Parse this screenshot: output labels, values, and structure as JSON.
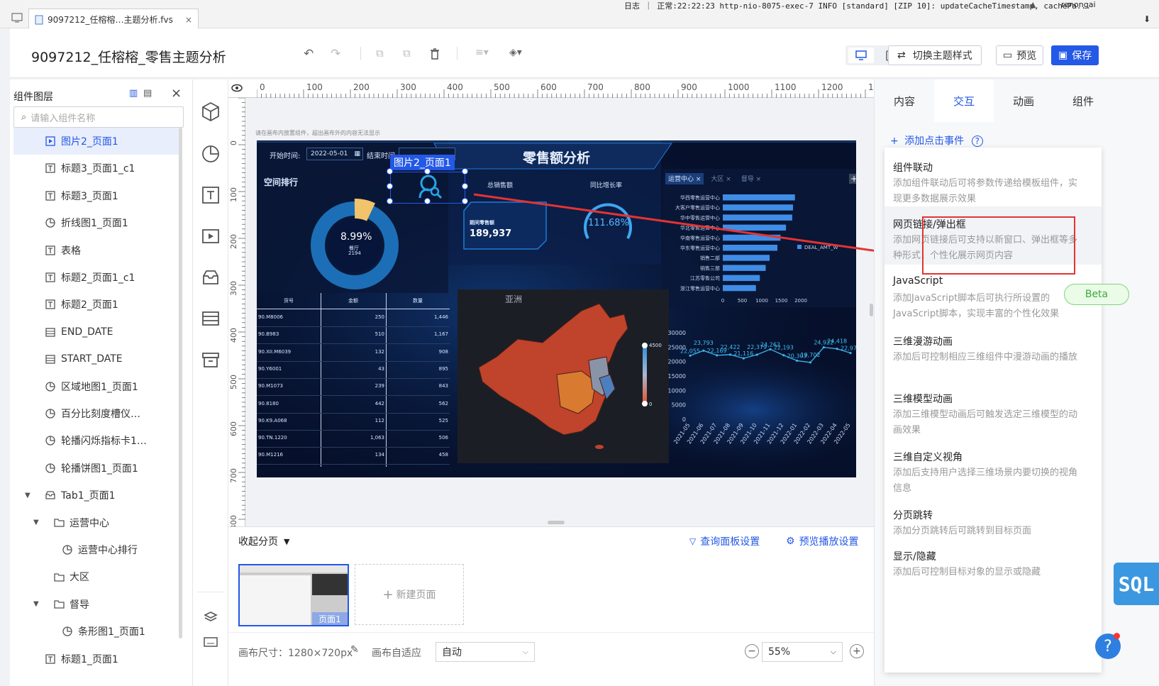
{
  "os": {
    "tab_title": "9097212_任榕榕…主题分析.fvs",
    "log_text": "日志 ｜ 正常:22:22:23 http-nio-8075-exec-7 INFO [standard] [ZIP 10]: updateCacheTimestamp, cachePa...",
    "user": "renongai"
  },
  "header": {
    "title": "9097212_任榕榕_零售主题分析",
    "switch_theme": "切换主题样式",
    "preview": "预览",
    "save": "保存"
  },
  "layers": {
    "title": "组件图层",
    "search_placeholder": "请输入组件名称",
    "items": [
      {
        "label": "图片2_页面1",
        "icon": "image-icon",
        "indent": 0,
        "selected": true
      },
      {
        "label": "标题3_页面1_c1",
        "icon": "text-icon",
        "indent": 0
      },
      {
        "label": "标题3_页面1",
        "icon": "text-icon",
        "indent": 0
      },
      {
        "label": "折线图1_页面1",
        "icon": "chart-icon",
        "indent": 0
      },
      {
        "label": "表格",
        "icon": "text-icon",
        "indent": 0
      },
      {
        "label": "标题2_页面1_c1",
        "icon": "text-icon",
        "indent": 0
      },
      {
        "label": "标题2_页面1",
        "icon": "text-icon",
        "indent": 0
      },
      {
        "label": "END_DATE",
        "icon": "date-icon",
        "indent": 0
      },
      {
        "label": "START_DATE",
        "icon": "date-icon",
        "indent": 0
      },
      {
        "label": "区域地图1_页面1",
        "icon": "chart-icon",
        "indent": 0
      },
      {
        "label": "百分比刻度槽仪…",
        "icon": "chart-icon",
        "indent": 0
      },
      {
        "label": "轮播闪烁指标卡1…",
        "icon": "chart-icon",
        "indent": 0
      },
      {
        "label": "轮播饼图1_页面1",
        "icon": "chart-icon",
        "indent": 0
      },
      {
        "label": "Tab1_页面1",
        "icon": "tab-icon",
        "indent": 0,
        "arrow": true
      },
      {
        "label": "运营中心",
        "icon": "folder-icon",
        "indent": 1,
        "arrow": true
      },
      {
        "label": "运营中心排行",
        "icon": "chart-icon",
        "indent": 2
      },
      {
        "label": "大区",
        "icon": "folder-icon",
        "indent": 1
      },
      {
        "label": "督导",
        "icon": "folder-icon",
        "indent": 1,
        "arrow": true
      },
      {
        "label": "条形图1_页面1",
        "icon": "chart-icon",
        "indent": 2
      },
      {
        "label": "标题1_页面1",
        "icon": "text-icon",
        "indent": 0
      }
    ]
  },
  "canvas": {
    "hint": "请在画布内放置组件，超出画布外的内容无法显示",
    "ruler_top": [
      "0",
      "100",
      "200",
      "300",
      "400",
      "500",
      "600",
      "700",
      "800",
      "900",
      "1000",
      "1100",
      "1200",
      "1"
    ],
    "ruler_left": [
      "0",
      "100",
      "200",
      "300",
      "400",
      "500",
      "600",
      "700",
      "800"
    ],
    "selected_label": "图片2_页面1"
  },
  "dashboard": {
    "title": "零售额分析",
    "start_label": "开始时间:",
    "start_date": "2022-05-01",
    "end_label": "结束时间",
    "section_rank": "空间排行",
    "donut_pct": "8.99%",
    "donut_sub1": "餐厅",
    "donut_sub2": "2194",
    "total_label": "总销售额",
    "yoy_label": "同比增长率",
    "card_label": "期间零售额",
    "card_value": "189,937",
    "gauge_value": "111.68%",
    "rank_tabs": [
      "运营中心 ×",
      "大区 ×",
      "督导 ×"
    ],
    "rank_legend": "DEAL_AMT_W",
    "rank_axis": [
      "0",
      "500",
      "1000",
      "1500",
      "2000"
    ],
    "table_headers": [
      "货号",
      "金额",
      "数量"
    ],
    "table_rows": [
      [
        "90.M8006",
        "250",
        "1,446"
      ],
      [
        "90.B983",
        "510",
        "1,167"
      ],
      [
        "90.XII.M6039",
        "132",
        "908"
      ],
      [
        "90.Y6001",
        "43",
        "895"
      ],
      [
        "90.M1073",
        "239",
        "843"
      ],
      [
        "90.8180",
        "442",
        "562"
      ],
      [
        "90.K9.A068",
        "112",
        "525"
      ],
      [
        "90.TN.1220",
        "1,063",
        "506"
      ],
      [
        "90.M1216",
        "134",
        "458"
      ]
    ],
    "map_label_asia": "亚洲",
    "map_scale_max": "4500",
    "map_scale_min": "0",
    "line_y_ticks": [
      "30000",
      "25000",
      "20000",
      "15000",
      "10000",
      "5000",
      "0"
    ],
    "line_x_ticks": [
      "2021-05",
      "2021-06",
      "2021-07",
      "2021-08",
      "2021-09",
      "2021-10",
      "2021-11",
      "2021-12",
      "2022-01",
      "2022-02",
      "2022-03",
      "2022-04",
      "2022-05"
    ]
  },
  "chart_data": [
    {
      "type": "bar",
      "categories": [
        "华西零售运营中心",
        "大客户零售运营中心",
        "华中零售运营中心",
        "华北零售运营中心",
        "华南零售运营中心",
        "华东零售运营中心",
        "销售二部",
        "销售三部",
        "江苏零售公司",
        "浙江零售运营中心"
      ],
      "values": [
        1850,
        1800,
        1780,
        1620,
        1480,
        1400,
        1200,
        1100,
        950,
        850
      ],
      "xlim": [
        0,
        2000
      ],
      "legend": "DEAL_AMT_W",
      "orientation": "horizontal"
    },
    {
      "type": "line",
      "x": [
        "2021-05",
        "2021-06",
        "2021-07",
        "2021-08",
        "2021-09",
        "2021-10",
        "2021-11",
        "2021-12",
        "2022-01",
        "2022-02",
        "2022-03",
        "2022-04",
        "2022-05"
      ],
      "values": [
        22055,
        23793,
        22169,
        22422,
        21116,
        22379,
        24262,
        22193,
        20303,
        19702,
        24922,
        24418,
        22976
      ],
      "ylim": [
        0,
        30000
      ]
    }
  ],
  "pages": {
    "collapse": "收起分页",
    "query_settings": "查询面板设置",
    "preview_settings": "预览播放设置",
    "page1": "页面1",
    "new_page": "新建页面",
    "canvas_size": "画布尺寸：1280×720px",
    "canvas_fit_label": "画布自适应",
    "canvas_fit_value": "自动",
    "zoom": "55%"
  },
  "right": {
    "tabs": [
      "内容",
      "交互",
      "动画",
      "组件"
    ],
    "active_tab": 1,
    "add_click": "添加点击事件",
    "menu": [
      {
        "title": "组件联动",
        "desc": "添加组件联动后可将参数传递给模板组件，实现更多数据展示效果"
      },
      {
        "title": "网页链接/弹出框",
        "desc": "添加网页链接后可支持以新窗口、弹出框等多种形式，个性化展示网页内容"
      },
      {
        "title": "JavaScript",
        "desc": "添加JavaScript脚本后可执行所设置的JavaScript脚本，实现丰富的个性化效果",
        "badge": "Beta"
      },
      {
        "title": "三维漫游动画",
        "desc": "添加后可控制相应三维组件中漫游动画的播放"
      },
      {
        "title": "三维模型动画",
        "desc": "添加三维模型动画后可触发选定三维模型的动画效果"
      },
      {
        "title": "三维自定义视角",
        "desc": "添加后支持用户选择三维场景内要切换的视角信息"
      },
      {
        "title": "分页跳转",
        "desc": "添加分页跳转后可跳转到目标页面"
      },
      {
        "title": "显示/隐藏",
        "desc": "添加后可控制目标对象的显示或隐藏"
      }
    ],
    "sql": "SQL"
  },
  "colors": {
    "accent": "#2458e6",
    "dash_bg": "#06102b",
    "map_red": "#c0432b",
    "highlight_red": "#e53333"
  }
}
